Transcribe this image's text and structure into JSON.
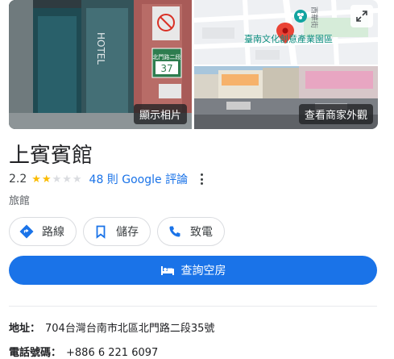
{
  "photos": {
    "main_caption": "顯示相片",
    "street_caption": "查看商家外觀",
    "main_sign_text": "HOTEL",
    "door_plate_text": "北門路二段",
    "door_plate_number": "37"
  },
  "map": {
    "place_label": "臺南文化創意產業園區",
    "road_label": "西華街",
    "expand_icon": "expand-icon"
  },
  "business": {
    "name": "上賓賓館",
    "rating": "2.2",
    "stars_filled": 2,
    "reviews": "48 則 Google 評論",
    "category": "旅館"
  },
  "actions": {
    "directions_label": "路線",
    "save_label": "儲存",
    "call_label": "致電",
    "book_label": "查詢空房"
  },
  "info": {
    "address_label": "地址：",
    "address_value": "704台灣台南市北區北門路二段35號",
    "phone_label": "電話號碼：",
    "phone_value": "+886 6 221 6097"
  },
  "colors": {
    "accent": "#1a73e8",
    "star": "#fbbc04",
    "pin": "#ea4335",
    "map_place": "#0f9d8c"
  }
}
